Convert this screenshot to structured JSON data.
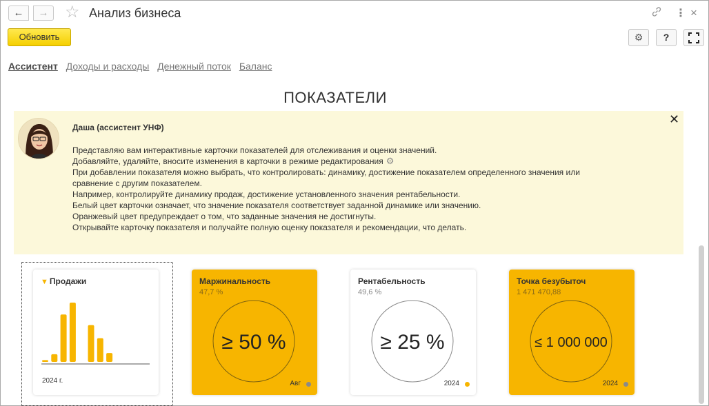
{
  "window": {
    "title": "Анализ бизнеса",
    "back_icon": "🡐",
    "forward_icon": "🡒"
  },
  "toolbar": {
    "update_label": "Обновить",
    "help_label": "?"
  },
  "tabs": [
    {
      "label": "Ассистент",
      "active": true
    },
    {
      "label": "Доходы и расходы",
      "active": false
    },
    {
      "label": "Денежный поток",
      "active": false
    },
    {
      "label": "Баланс",
      "active": false
    }
  ],
  "section_title": "ПОКАЗАТЕЛИ",
  "assistant": {
    "name": "Даша (ассистент УНФ)",
    "lines": [
      "Представляю вам интерактивные карточки показателей для отслеживания и оценки значений.",
      "Добавляйте, удаляйте, вносите изменения в карточки в режиме редактирования",
      "При  добавлении показателя можно выбрать, что контролировать: динамику, достижение показателем определенного значения или",
      "сравнение с другим показателем.",
      "Например, контролируйте динамику продаж, достижение установленного значения рентабельности.",
      "Белый цвет карточки означает, что значение показателя соответствует заданной динамике или значению.",
      "Оранжевый цвет предупреждает о том, что заданные значения не достигнуты.",
      "Открывайте карточку показателя и получайте полную оценку показателя и рекомендации, что делать."
    ]
  },
  "cards": {
    "sales": {
      "title": "Продажи",
      "period": "2024 г.",
      "bars": [
        0.03,
        0.13,
        0.8,
        1.0,
        0.0,
        0.62,
        0.4,
        0.15
      ],
      "color": "#f7b500"
    },
    "margin": {
      "title": "Маржинальность",
      "value": "47,7 %",
      "target": "≥ 50 %",
      "period": "Авг",
      "state": "orange",
      "dot_color": "#8a8a8a"
    },
    "profitability": {
      "title": "Рентабельность",
      "value": "49,6 %",
      "target": "≥ 25 %",
      "period": "2024",
      "state": "white",
      "dot_color": "#f7b500"
    },
    "breakeven": {
      "title": "Точка безубыточ",
      "value": "1 471 470,88",
      "target": "≤ 1 000 000",
      "period": "2024",
      "state": "orange",
      "dot_color": "#8a8a8a"
    }
  },
  "colors": {
    "accent": "#f7b500",
    "assistant_bg": "#fcf8da",
    "button_yellow": "#f5d000"
  }
}
